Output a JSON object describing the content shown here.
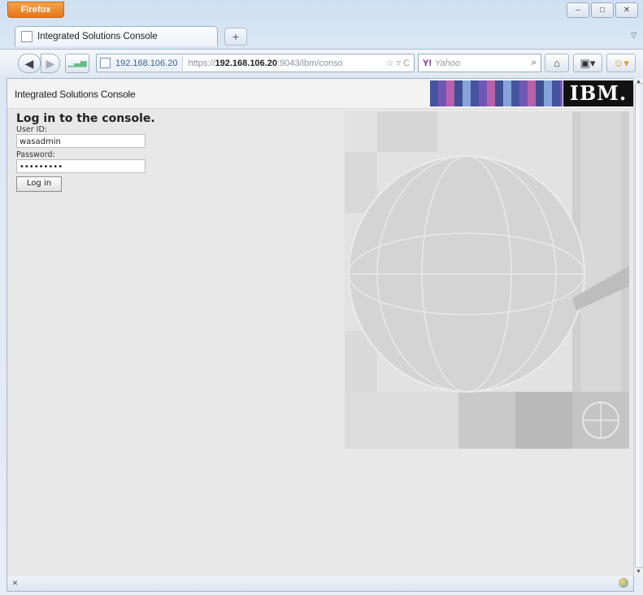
{
  "browser": {
    "menu_button": "Firefox",
    "window_buttons": [
      "–",
      "□",
      "✕"
    ],
    "tab_title": "Integrated Solutions Console",
    "new_tab": "+",
    "url_identity": "192.168.106.20",
    "url_prefix": "https://",
    "url_host": "192.168.106.20",
    "url_rest": ":9043/ibm/conso",
    "url_icons": "☆ ▿ C",
    "search_engine": "Y!",
    "search_placeholder": "Yahoo",
    "status_close": "×"
  },
  "app": {
    "title": "Integrated Solutions Console",
    "logo": "IBM."
  },
  "login": {
    "heading": "Log in to the console.",
    "userid_label": "User ID:",
    "userid_value": "wasadmin",
    "password_label": "Password:",
    "password_value": "•••••••••",
    "login_button": "Log in"
  }
}
